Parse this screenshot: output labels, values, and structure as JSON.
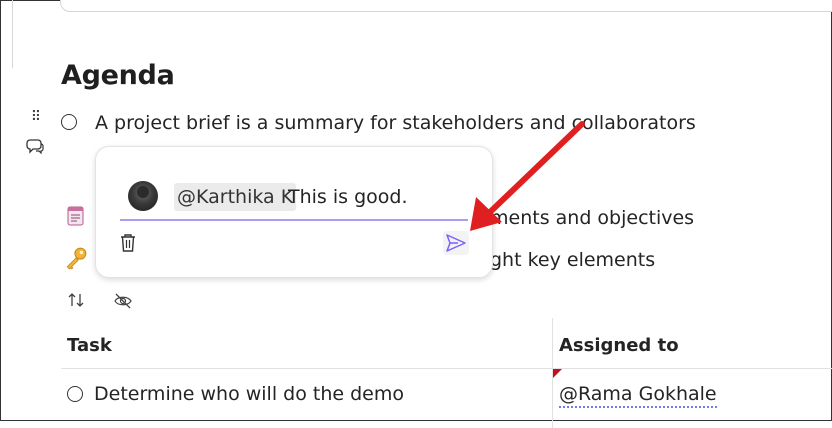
{
  "section": {
    "heading": "Agenda"
  },
  "lines": [
    {
      "text": "A project brief is a summary for stakeholders and collaborators"
    },
    {
      "text": "ments and objectives"
    },
    {
      "text": "ght key elements"
    }
  ],
  "comment": {
    "mention": "@Karthika K",
    "text": "This is good.",
    "avatar": "user-avatar"
  },
  "table": {
    "headers": [
      "Task",
      "Assigned to"
    ],
    "rows": [
      {
        "task": "Determine who will do the demo",
        "assigned": "@Rama Gokhale"
      }
    ]
  },
  "icons": {
    "drag": "drag-handle-icon",
    "comment_side": "comment-icon",
    "notes": "notepad-emoji-icon",
    "key": "key-emoji-icon",
    "sort": "sort-arrows-icon",
    "hide": "eye-slash-icon",
    "trash": "trash-icon",
    "send": "send-icon"
  },
  "colors": {
    "accent": "#8b7cf0",
    "annotation": "#e02020",
    "send_icon": "#7b61ff"
  }
}
